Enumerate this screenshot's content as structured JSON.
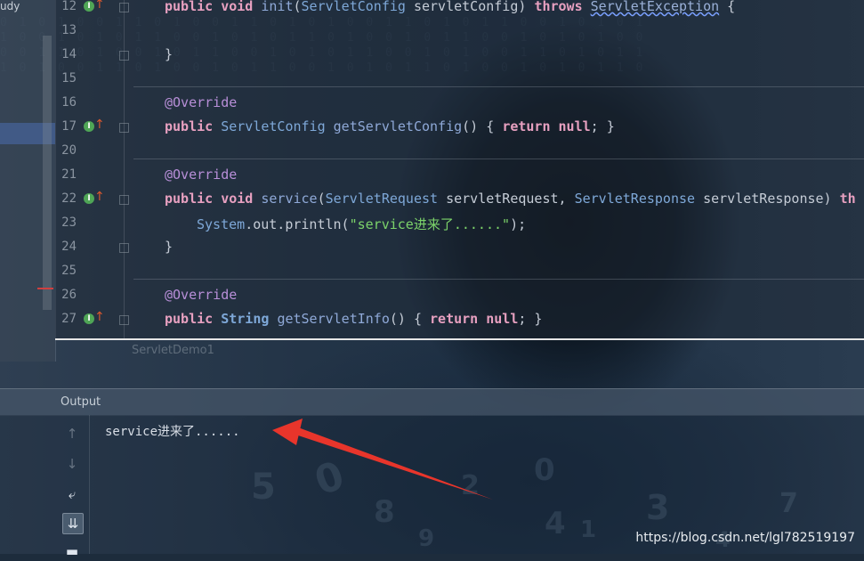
{
  "project_panel": {
    "label": "udy"
  },
  "editor": {
    "lines": [
      {
        "num": "12",
        "icons": true
      },
      {
        "num": "13"
      },
      {
        "num": "14"
      },
      {
        "num": "15"
      },
      {
        "num": "16"
      },
      {
        "num": "17",
        "icons": true
      },
      {
        "num": "20"
      },
      {
        "num": "21"
      },
      {
        "num": "22",
        "icons": true
      },
      {
        "num": "23"
      },
      {
        "num": "24"
      },
      {
        "num": "25"
      },
      {
        "num": "26"
      },
      {
        "num": "27",
        "icons": true
      }
    ],
    "code": {
      "l12a": "public void ",
      "l12b": "init",
      "l12c": "(",
      "l12d": "ServletConfig",
      "l12e": " servletConfig) ",
      "l12f": "throws ",
      "l12g": "ServletException",
      "l12h": " {",
      "l14": "}",
      "l16": "@Override",
      "l17a": "public ",
      "l17b": "ServletConfig ",
      "l17c": "getServletConfig",
      "l17d": "() { ",
      "l17e": "return null",
      "l17f": "; }",
      "l21": "@Override",
      "l22a": "public void ",
      "l22b": "service",
      "l22c": "(",
      "l22d": "ServletRequest",
      "l22e": " servletRequest, ",
      "l22f": "ServletResponse",
      "l22g": " servletResponse) ",
      "l22h": "th",
      "l23a": "System",
      "l23b": ".out.println(",
      "l23c": "\"service进来了......\"",
      "l23d": ");",
      "l24": "}",
      "l26": "@Override",
      "l27a": "public ",
      "l27b": "String ",
      "l27c": "getServletInfo",
      "l27d": "() { ",
      "l27e": "return null",
      "l27f": "; }"
    },
    "tab_name": "ServletDemo1"
  },
  "output": {
    "title": "Output",
    "text": "service进来了......",
    "toolbar": [
      {
        "name": "up-arrow-icon",
        "glyph": "↑"
      },
      {
        "name": "down-arrow-icon",
        "glyph": "↓"
      },
      {
        "name": "soft-wrap-icon",
        "glyph": "⤶"
      },
      {
        "name": "scroll-to-end-icon",
        "glyph": "⇊"
      },
      {
        "name": "print-icon",
        "glyph": "▬"
      }
    ]
  },
  "background_digits": [
    "5",
    "0",
    "2",
    "0",
    "4",
    "3",
    "7",
    "8",
    "1",
    "4",
    "9"
  ],
  "watermark": "https://blog.csdn.net/lgl782519197",
  "colors": {
    "arrow": "#e8352b",
    "keyword": "#e7a0c0",
    "string": "#7cd36a",
    "annotation": "#b88fd8"
  }
}
